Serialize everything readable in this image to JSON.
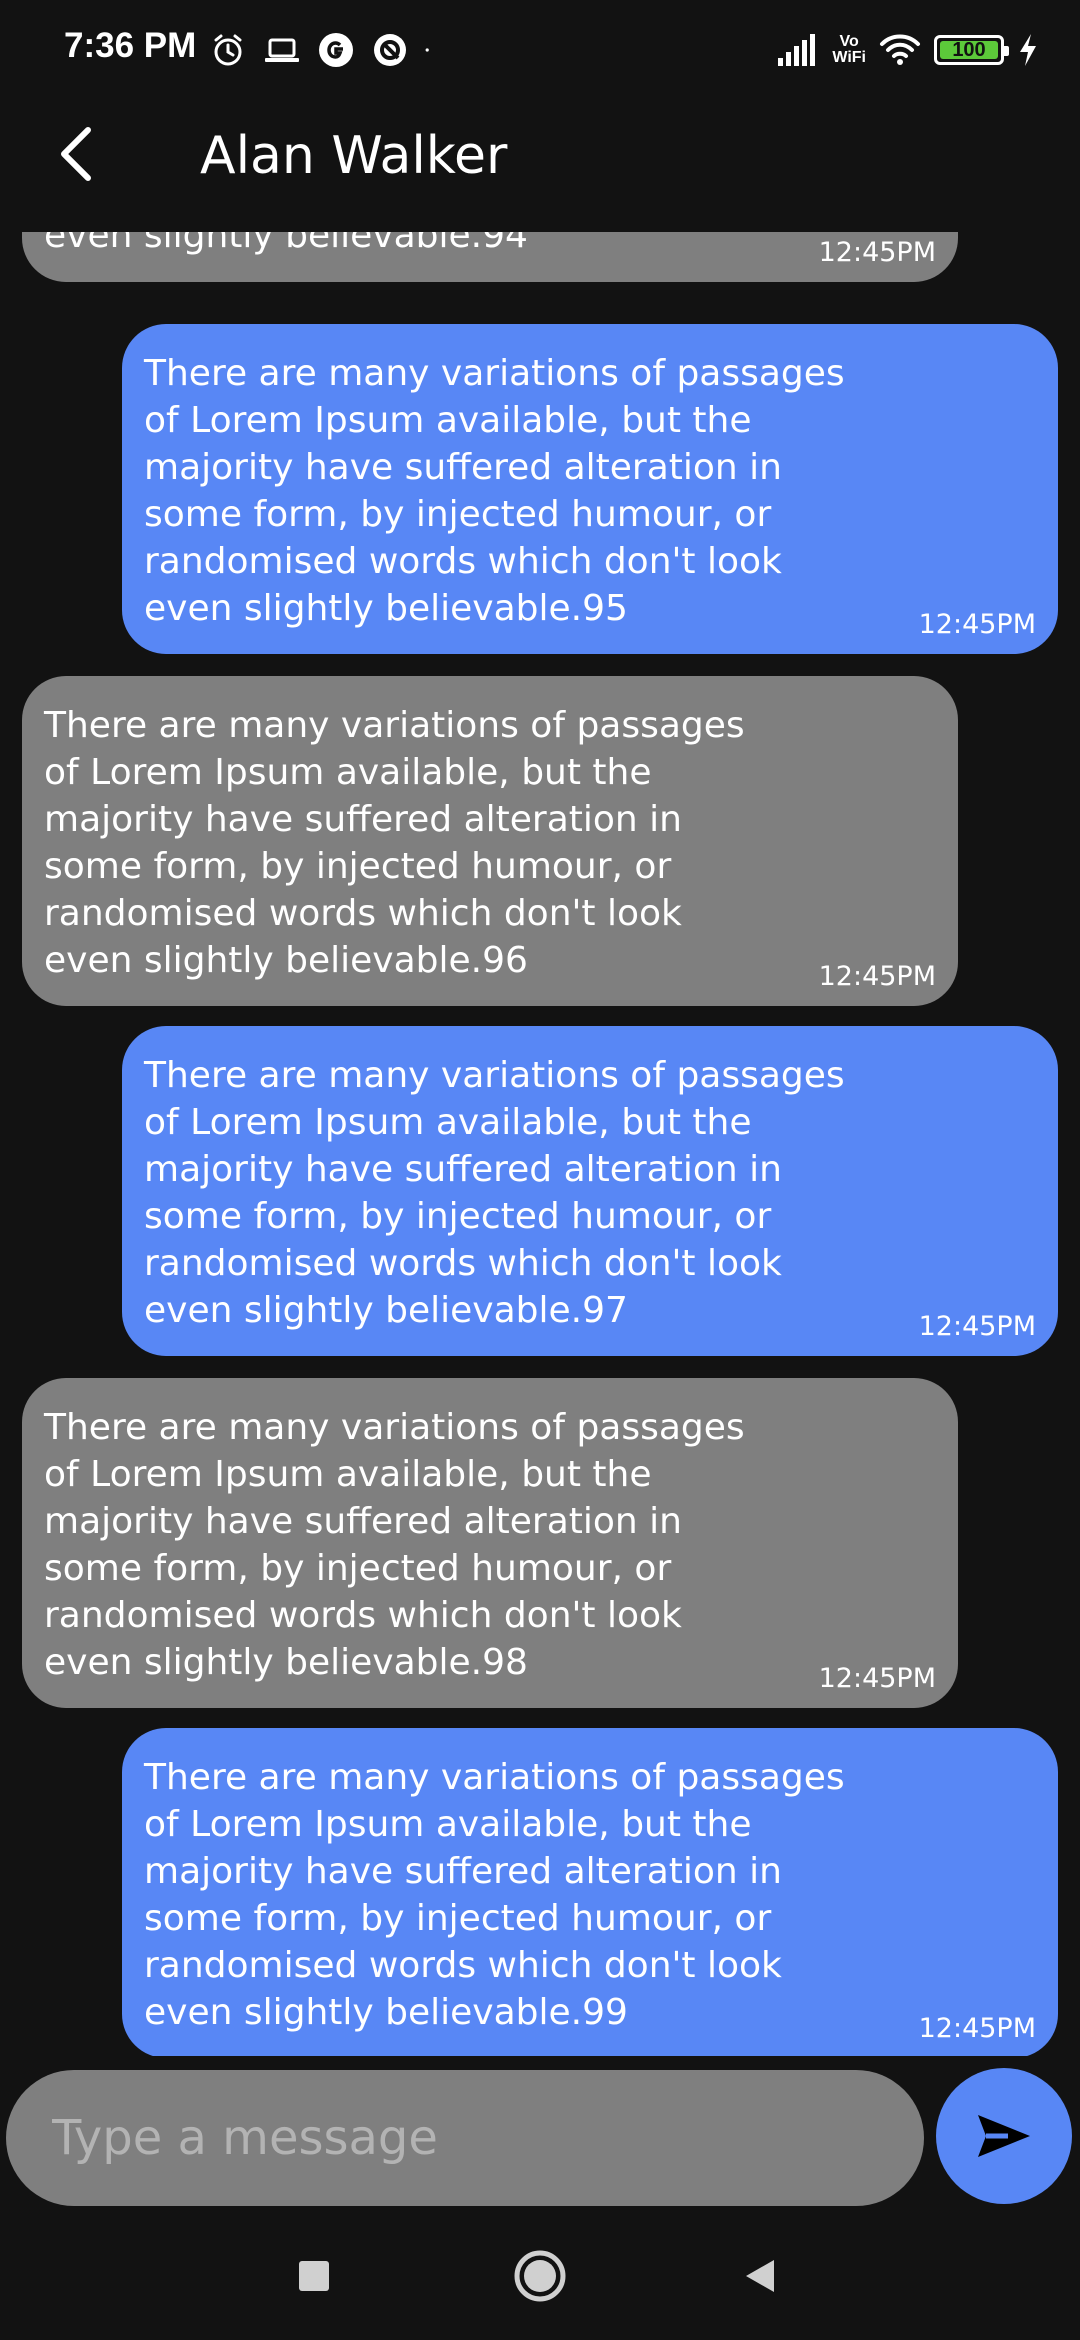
{
  "status_bar": {
    "time": "7:36 PM",
    "battery_level": "100",
    "network": "Vo WiFi",
    "left_icons": [
      "alarm-icon",
      "laptop-icon",
      "google-icon",
      "data-saver-icon",
      "dot-icon"
    ],
    "right_icons": [
      "signal-icon",
      "vowifi-icon",
      "wifi-icon",
      "battery-icon",
      "charging-icon"
    ]
  },
  "header": {
    "back_icon": "chevron-left-icon",
    "title": "Alan Walker"
  },
  "messages": [
    {
      "direction": "received",
      "text": "even slightly believable.94",
      "time": "12:45PM"
    },
    {
      "direction": "sent",
      "text": "There are many variations of passages\nof Lorem Ipsum available, but the\nmajority have suffered alteration in\nsome form, by injected humour, or\nrandomised words which don't look\neven slightly believable.95",
      "time": "12:45PM"
    },
    {
      "direction": "received",
      "text": "There are many variations of passages\nof Lorem Ipsum available, but the\nmajority have suffered alteration in\nsome form, by injected humour, or\nrandomised words which don't look\neven slightly believable.96",
      "time": "12:45PM"
    },
    {
      "direction": "sent",
      "text": "There are many variations of passages\nof Lorem Ipsum available, but the\nmajority have suffered alteration in\nsome form, by injected humour, or\nrandomised words which don't look\neven slightly believable.97",
      "time": "12:45PM"
    },
    {
      "direction": "received",
      "text": "There are many variations of passages\nof Lorem Ipsum available, but the\nmajority have suffered alteration in\nsome form, by injected humour, or\nrandomised words which don't look\neven slightly believable.98",
      "time": "12:45PM"
    },
    {
      "direction": "sent",
      "text": "There are many variations of passages\nof Lorem Ipsum available, but the\nmajority have suffered alteration in\nsome form, by injected humour, or\nrandomised words which don't look\neven slightly believable.99",
      "time": "12:45PM"
    }
  ],
  "composer": {
    "placeholder": "Type a message",
    "value": "",
    "send_icon": "send-icon"
  },
  "nav": {
    "icons": [
      "recents-icon",
      "home-icon",
      "back-icon"
    ]
  },
  "colors": {
    "background": "#121212",
    "sent_bubble": "#5887f5",
    "received_bubble": "#7f7f7f",
    "battery_fill": "#5cc93a"
  }
}
